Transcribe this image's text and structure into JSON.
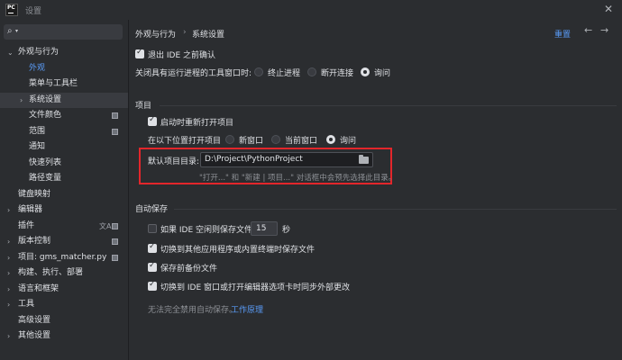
{
  "window": {
    "logo_text": "PC",
    "title": "设置",
    "close_glyph": "✕"
  },
  "sidebar": {
    "search_placeholder": "",
    "items": [
      {
        "label": "外观与行为",
        "arrow": "⌄",
        "level": 0
      },
      {
        "label": "外观",
        "level": 1,
        "active": true
      },
      {
        "label": "菜单与工具栏",
        "level": 1
      },
      {
        "label": "系统设置",
        "arrow": "›",
        "level": 1,
        "selected": true
      },
      {
        "label": "文件颜色",
        "level": 1,
        "badge": true
      },
      {
        "label": "范围",
        "level": 1,
        "badge": true
      },
      {
        "label": "通知",
        "level": 1
      },
      {
        "label": "快速列表",
        "level": 1
      },
      {
        "label": "路径变量",
        "level": 1
      },
      {
        "label": "键盘映射",
        "level": 0
      },
      {
        "label": "编辑器",
        "arrow": "›",
        "level": 0
      },
      {
        "label": "插件",
        "level": 0,
        "lang": true,
        "badge": true
      },
      {
        "label": "版本控制",
        "arrow": "›",
        "level": 0,
        "badge": true
      },
      {
        "label": "项目: gms_matcher.py",
        "arrow": "›",
        "level": 0,
        "badge": true
      },
      {
        "label": "构建、执行、部署",
        "arrow": "›",
        "level": 0
      },
      {
        "label": "语言和框架",
        "arrow": "›",
        "level": 0
      },
      {
        "label": "工具",
        "arrow": "›",
        "level": 0
      },
      {
        "label": "高级设置",
        "level": 0
      },
      {
        "label": "其他设置",
        "arrow": "›",
        "level": 0
      }
    ]
  },
  "header": {
    "breadcrumb_parent": "外观与行为",
    "breadcrumb_sep": "›",
    "breadcrumb_current": "系统设置",
    "reset_label": "重置",
    "back_glyph": "←",
    "forward_glyph": "→"
  },
  "general": {
    "confirm_exit_label": "退出 IDE 之前确认",
    "confirm_exit_checked": true,
    "close_tool_label": "关闭具有运行进程的工具窗口时:",
    "close_tool_options": [
      "终止进程",
      "断开连接",
      "询问"
    ],
    "close_tool_selected": 2
  },
  "project": {
    "section_title": "项目",
    "reopen_label": "启动时重新打开项目",
    "reopen_checked": true,
    "open_in_label": "在以下位置打开项目",
    "open_in_options": [
      "新窗口",
      "当前窗口",
      "询问"
    ],
    "open_in_selected": 2,
    "default_dir_label": "默认项目目录:",
    "default_dir_value": "D:\\Project\\PythonProject",
    "default_dir_hint": "\"打开...\" 和 \"新建 | 项目...\" 对话框中会预先选择此目录。"
  },
  "autosave": {
    "section_title": "自动保存",
    "idle_save_label": "如果 IDE 空闲则保存文件",
    "idle_save_checked": false,
    "idle_seconds": "15",
    "seconds_unit": "秒",
    "switch_app_label": "切换到其他应用程序或内置终端时保存文件",
    "switch_app_checked": true,
    "backup_label": "保存前备份文件",
    "backup_checked": true,
    "sync_label": "切换到 IDE 窗口或打开编辑器选项卡时同步外部更改",
    "sync_checked": true,
    "disable_hint": "无法完全禁用自动保存。",
    "disable_link": "工作原理"
  },
  "colors": {
    "accent": "#5a9cf8",
    "highlight_border": "#e3262b",
    "background": "#2b2d30"
  }
}
